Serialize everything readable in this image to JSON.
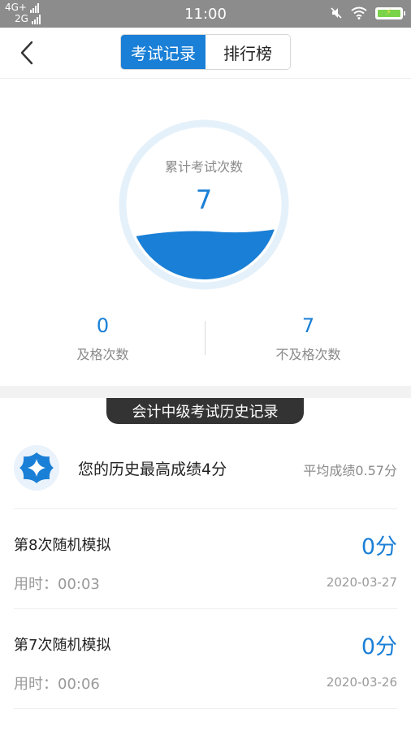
{
  "status_bar": {
    "network_top": "4G+",
    "network_bottom": "2G",
    "time": "11:00",
    "icons": [
      "mute-icon",
      "wifi-icon",
      "battery-charging-icon"
    ],
    "battery_color": "#7bd34a"
  },
  "nav": {
    "back_icon": "chevron-left-icon",
    "tabs": [
      {
        "label": "考试记录",
        "active": true
      },
      {
        "label": "排行榜",
        "active": false
      }
    ],
    "accent_color": "#1a7fd6"
  },
  "summary": {
    "total_label": "累计考试次数",
    "total_value": "7",
    "pass_value": "0",
    "pass_label": "及格次数",
    "fail_value": "7",
    "fail_label": "不及格次数"
  },
  "history": {
    "badge": "会计中级考试历史记录",
    "best_icon": "star-badge-icon",
    "best_text": "您的历史最高成绩4分",
    "avg_text": "平均成绩0.57分",
    "records": [
      {
        "title": "第8次随机模拟",
        "score": "0分",
        "duration": "用时：00:03",
        "date": "2020-03-27"
      },
      {
        "title": "第7次随机模拟",
        "score": "0分",
        "duration": "用时：00:06",
        "date": "2020-03-26"
      }
    ]
  }
}
